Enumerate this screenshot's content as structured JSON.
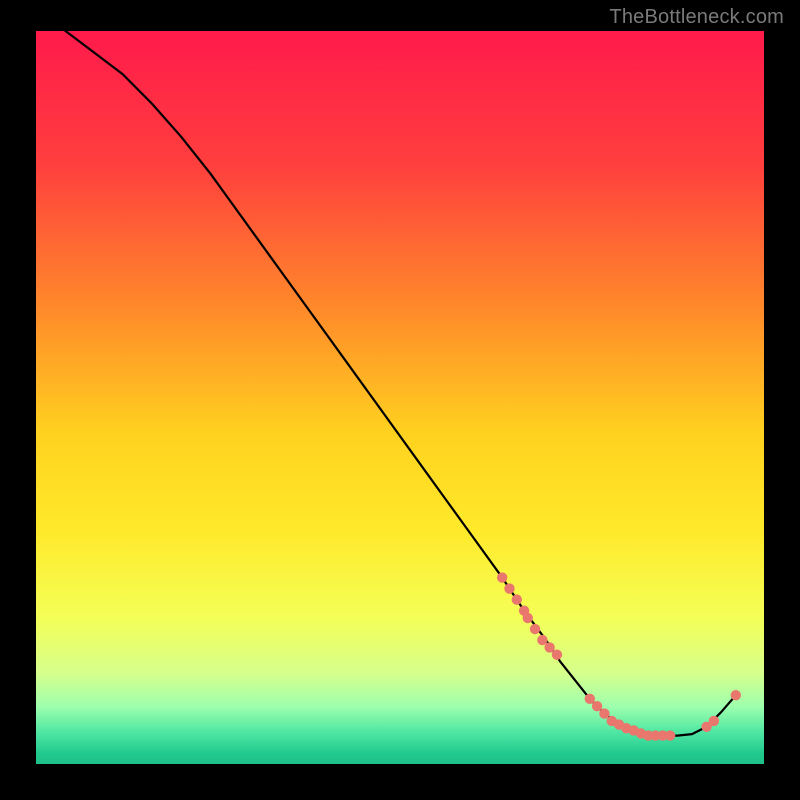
{
  "watermark": "TheBottleneck.com",
  "marker_color": "#e9776d",
  "chart_data": {
    "type": "line",
    "title": "",
    "xlabel": "",
    "ylabel": "",
    "xlim": [
      0,
      100
    ],
    "ylim": [
      0,
      100
    ],
    "gradient_stops": [
      {
        "offset": 0.0,
        "color": "#ff1a4b"
      },
      {
        "offset": 0.18,
        "color": "#ff3e3e"
      },
      {
        "offset": 0.38,
        "color": "#ff8a2a"
      },
      {
        "offset": 0.55,
        "color": "#ffd21f"
      },
      {
        "offset": 0.68,
        "color": "#ffe92a"
      },
      {
        "offset": 0.8,
        "color": "#f4ff57"
      },
      {
        "offset": 0.875,
        "color": "#d6ff8c"
      },
      {
        "offset": 0.92,
        "color": "#9fffad"
      },
      {
        "offset": 0.955,
        "color": "#4fe7a3"
      },
      {
        "offset": 0.985,
        "color": "#21c98e"
      },
      {
        "offset": 1.0,
        "color": "#1fbf88"
      }
    ],
    "line": {
      "x": [
        4,
        8,
        12,
        16,
        20,
        24,
        28,
        32,
        36,
        40,
        44,
        48,
        52,
        56,
        60,
        64,
        67,
        70,
        72,
        74,
        76,
        78,
        80,
        82,
        84,
        86,
        88,
        90,
        92,
        94,
        96
      ],
      "y": [
        100,
        97,
        94,
        90,
        85.5,
        80.5,
        75,
        69.5,
        64,
        58.5,
        53,
        47.5,
        42,
        36.5,
        31,
        25.5,
        21,
        17,
        14,
        11.5,
        9,
        7,
        5.5,
        4.5,
        4,
        4,
        4,
        4.2,
        5.2,
        7.2,
        9.5
      ]
    },
    "markers": {
      "x": [
        64,
        65,
        66,
        67,
        67.5,
        68.5,
        69.5,
        70.5,
        71.5,
        76,
        77,
        78,
        79,
        80,
        81,
        82,
        83,
        84,
        85,
        86,
        87,
        92,
        93,
        96
      ],
      "y": [
        25.5,
        24,
        22.5,
        21,
        20,
        18.5,
        17,
        16,
        15,
        9,
        8,
        7,
        6,
        5.5,
        5,
        4.7,
        4.3,
        4,
        4,
        4,
        4,
        5.2,
        6,
        9.5
      ]
    }
  }
}
